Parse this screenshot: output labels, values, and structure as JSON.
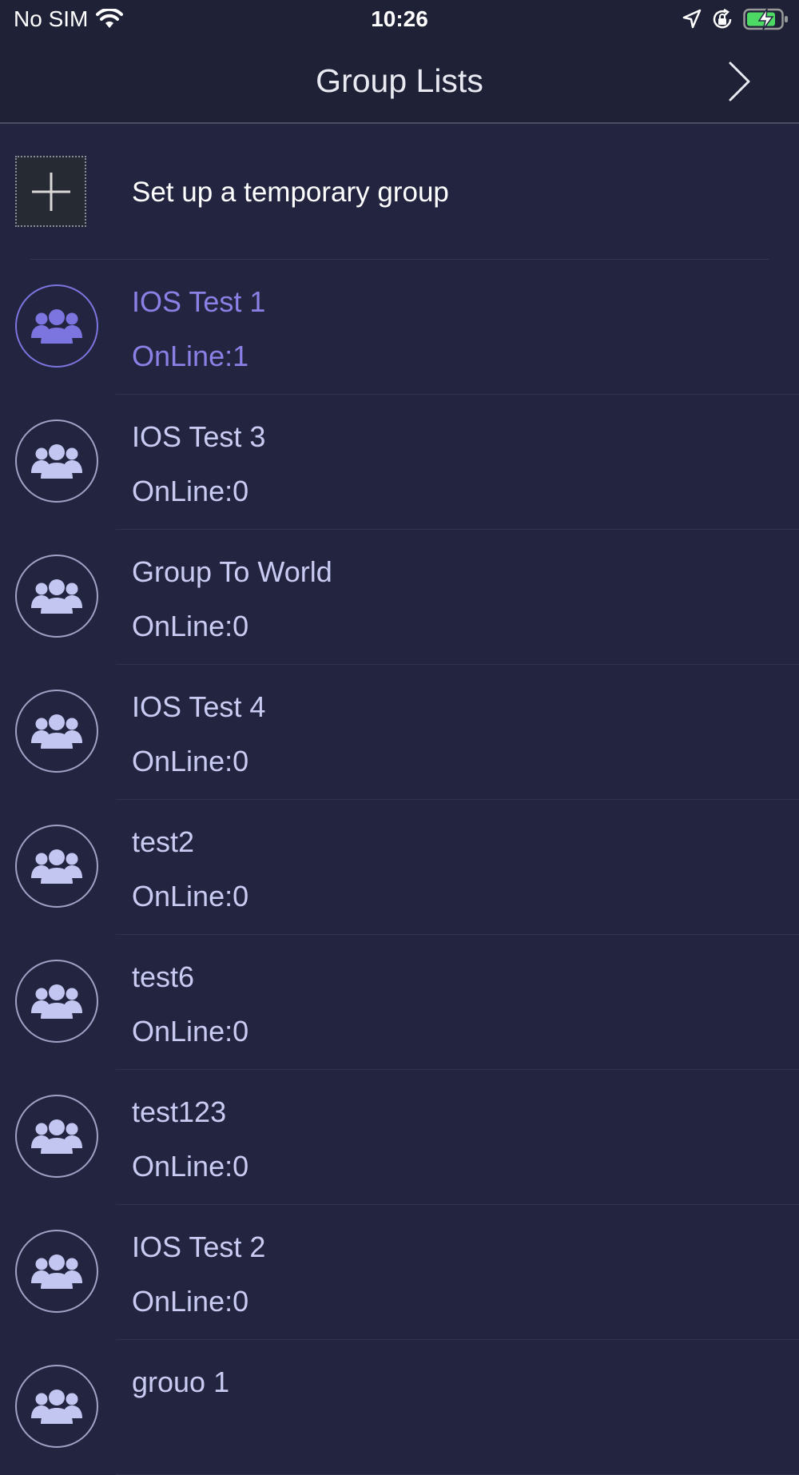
{
  "status": {
    "carrier": "No SIM",
    "time": "10:26",
    "icons": [
      "wifi-icon",
      "location-arrow-icon",
      "rotation-lock-icon",
      "battery-charging-icon"
    ]
  },
  "nav": {
    "title": "Group Lists",
    "forward_icon": "chevron-right-icon"
  },
  "create": {
    "label": "Set up a temporary group",
    "icon": "plus-icon"
  },
  "colors": {
    "background": "#232540",
    "selected_text": "#8a80e6",
    "list_text": "#c9cbf2",
    "avatar_selected": "#7c74df",
    "avatar_default": "#c3c6f0"
  },
  "groups": [
    {
      "name": "IOS Test 1",
      "online": "OnLine:1",
      "selected": true
    },
    {
      "name": "IOS Test 3",
      "online": "OnLine:0",
      "selected": false
    },
    {
      "name": "Group To World",
      "online": "OnLine:0",
      "selected": false
    },
    {
      "name": "IOS Test 4",
      "online": "OnLine:0",
      "selected": false
    },
    {
      "name": "test2",
      "online": "OnLine:0",
      "selected": false
    },
    {
      "name": "test6",
      "online": "OnLine:0",
      "selected": false
    },
    {
      "name": "test123",
      "online": "OnLine:0",
      "selected": false
    },
    {
      "name": "IOS Test 2",
      "online": "OnLine:0",
      "selected": false
    },
    {
      "name": "grouo 1",
      "online": "",
      "selected": false
    }
  ]
}
